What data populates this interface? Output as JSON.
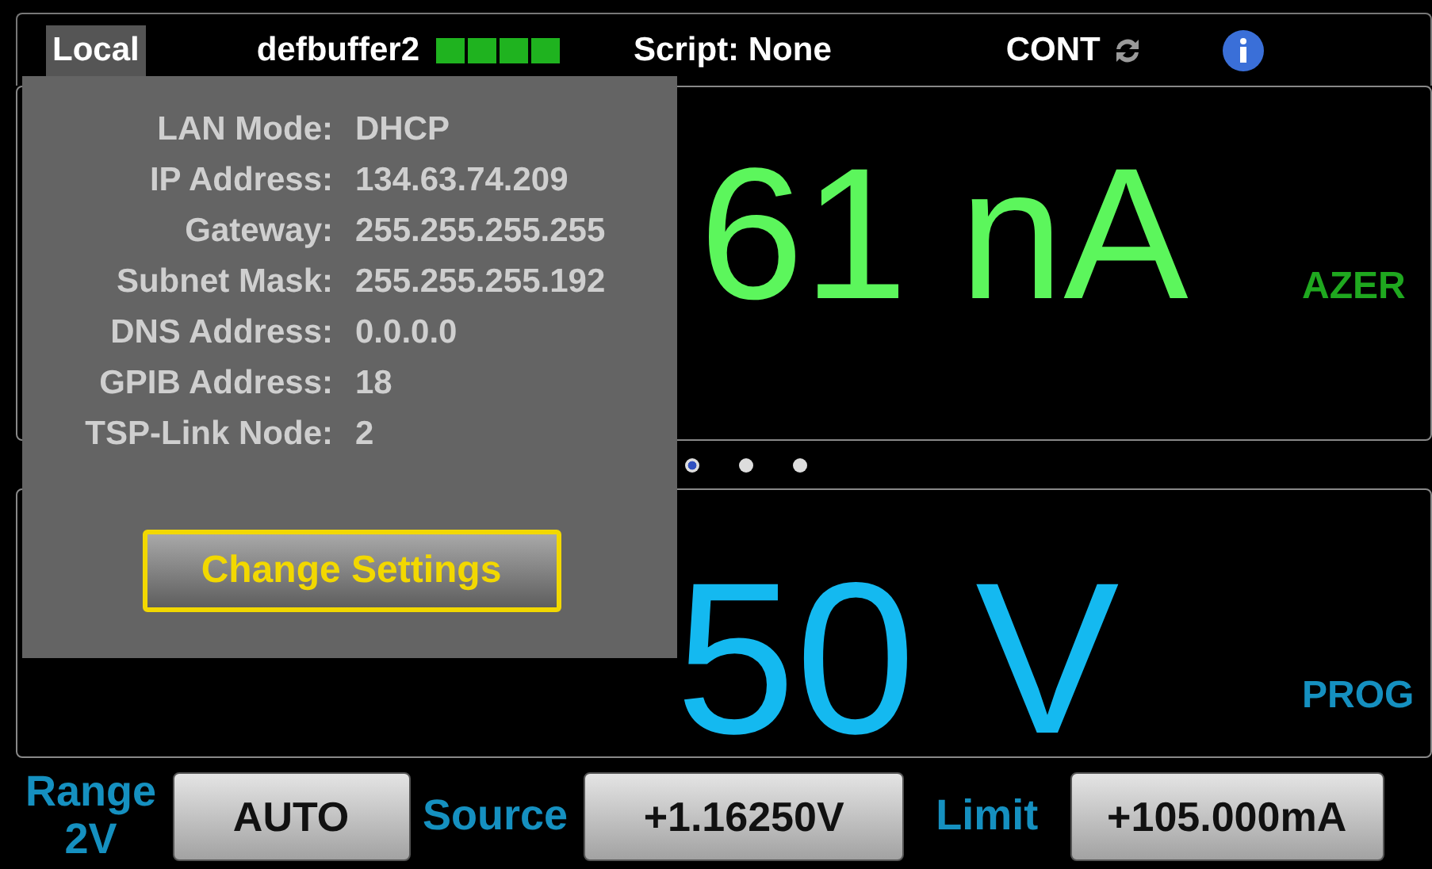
{
  "status_bar": {
    "mode": "Local",
    "buffer": "defbuffer2",
    "script": "Script: None",
    "trigger": "CONT"
  },
  "network_popup": {
    "fields": [
      {
        "label": "LAN Mode:",
        "value": "DHCP"
      },
      {
        "label": "IP Address:",
        "value": "134.63.74.209"
      },
      {
        "label": "Gateway:",
        "value": "255.255.255.255"
      },
      {
        "label": "Subnet Mask:",
        "value": "255.255.255.192"
      },
      {
        "label": "DNS Address:",
        "value": "0.0.0.0"
      },
      {
        "label": "GPIB Address:",
        "value": "18"
      },
      {
        "label": "TSP-Link Node:",
        "value": "2"
      }
    ],
    "button": "Change Settings"
  },
  "measure": {
    "reading": "61 nA",
    "indicator": "AZER"
  },
  "swipe_dots": [
    {
      "selected": true
    },
    {
      "selected": false
    },
    {
      "selected": false
    }
  ],
  "source": {
    "reading": "50 V",
    "indicator": "PROG"
  },
  "settings": [
    {
      "label": "Range",
      "sublabel": "2V",
      "value": "AUTO"
    },
    {
      "label": "Source",
      "value": "+1.16250V"
    },
    {
      "label": "Limit",
      "value": "+105.000mA"
    }
  ]
}
